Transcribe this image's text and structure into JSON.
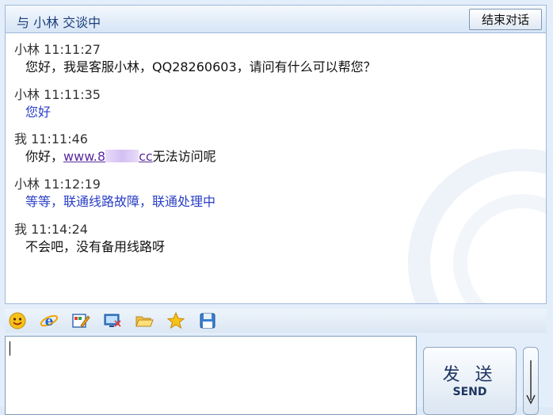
{
  "header": {
    "title": "与 小林 交谈中",
    "end_chat_label": "结束对话"
  },
  "messages": [
    {
      "sender": "小林",
      "time": "11:11:27",
      "type": "agent-first",
      "text": "您好，我是客服小林，QQ28260603，请问有什么可以帮您？"
    },
    {
      "sender": "小林",
      "time": "11:11:35",
      "type": "agent",
      "text": "您好"
    },
    {
      "sender": "我",
      "time": "11:11:46",
      "type": "customer",
      "greeting": "你好，",
      "link_start": "www.8",
      "link_end": "cc",
      "rest": "无法访问呢"
    },
    {
      "sender": "小林",
      "time": "11:12:19",
      "type": "agent",
      "text": "等等，联通线路故障，联通处理中"
    },
    {
      "sender": "我",
      "time": "11:14:24",
      "type": "customer",
      "text": "不会吧，没有备用线路呀"
    }
  ],
  "toolbar": {
    "icons": [
      "smiley-icon",
      "ie-browser-icon",
      "edit-note-icon",
      "screen-capture-icon",
      "open-folder-icon",
      "star-icon",
      "save-disk-icon"
    ]
  },
  "input": {
    "value": ""
  },
  "send": {
    "label_cn": "发 送",
    "label_en": "SEND"
  },
  "colors": {
    "agent_text": "#2a3fc6",
    "header_text": "#1d3f7a",
    "link": "#5b2aa0"
  }
}
